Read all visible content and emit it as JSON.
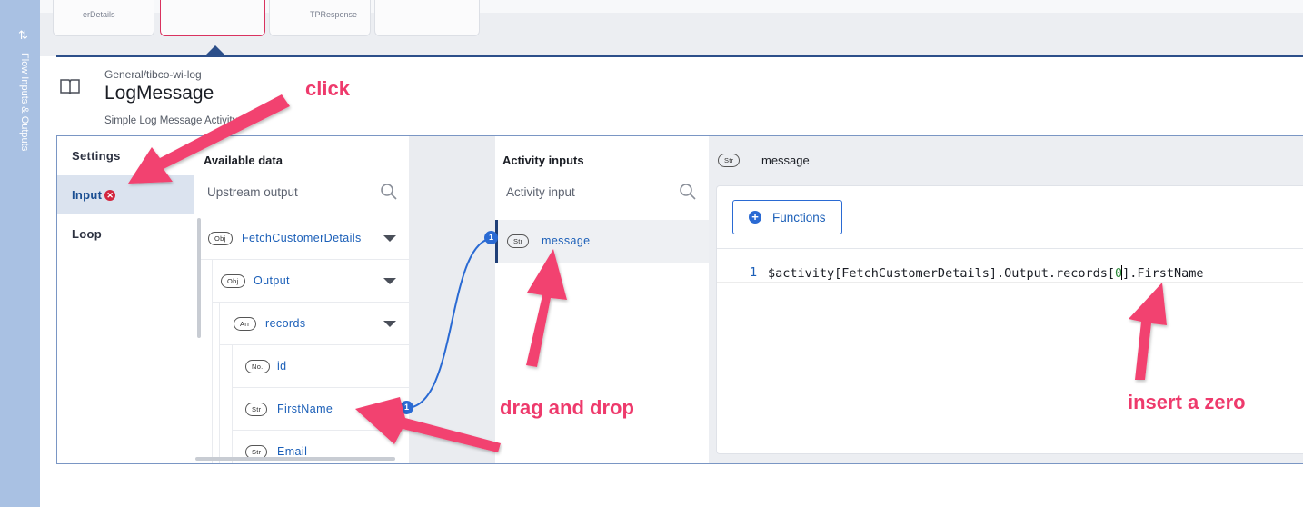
{
  "rail": {
    "label": "Flow Inputs & Outputs",
    "toggle_icon": "swap-icon"
  },
  "flow": {
    "tiles": [
      {
        "label": "erDetails"
      },
      {
        "label": ""
      },
      {
        "label": "TPResponse"
      },
      {
        "label": ""
      }
    ]
  },
  "activity": {
    "category": "General/tibco-wi-log",
    "title": "LogMessage",
    "subtitle": "Simple Log Message Activity"
  },
  "tabs": [
    {
      "label": "Settings",
      "active": false
    },
    {
      "label": "Input",
      "active": true,
      "error": true
    },
    {
      "label": "Loop",
      "active": false
    }
  ],
  "available": {
    "header": "Available data",
    "search_placeholder": "Upstream output",
    "tree": [
      {
        "type": "Obj",
        "label": "FetchCustomerDetails",
        "expanded": true
      },
      {
        "type": "Obj",
        "label": "Output",
        "expanded": true
      },
      {
        "type": "Arr",
        "label": "records",
        "expanded": true
      },
      {
        "type": "No.",
        "label": "id"
      },
      {
        "type": "Str",
        "label": "FirstName",
        "mapped_count": "1"
      },
      {
        "type": "Str",
        "label": "Email"
      }
    ]
  },
  "activity_inputs": {
    "header": "Activity inputs",
    "search_placeholder": "Activity input",
    "items": [
      {
        "type": "Str",
        "label": "message",
        "mapped_count": "1"
      }
    ]
  },
  "editor": {
    "field_type": "Str",
    "field_name": "message",
    "functions_label": "Functions",
    "line_number": "1",
    "code_before": "$activity[FetchCustomerDetails].Output.records[",
    "code_index": "0",
    "code_after": "].FirstName"
  },
  "annotations": {
    "click": "click",
    "drag": "drag and drop",
    "insert": "insert a zero"
  },
  "colors": {
    "accent": "#2a6ad3",
    "annotation": "#ee3a6c",
    "error": "#d3273f",
    "rail": "#a9c1e3"
  }
}
